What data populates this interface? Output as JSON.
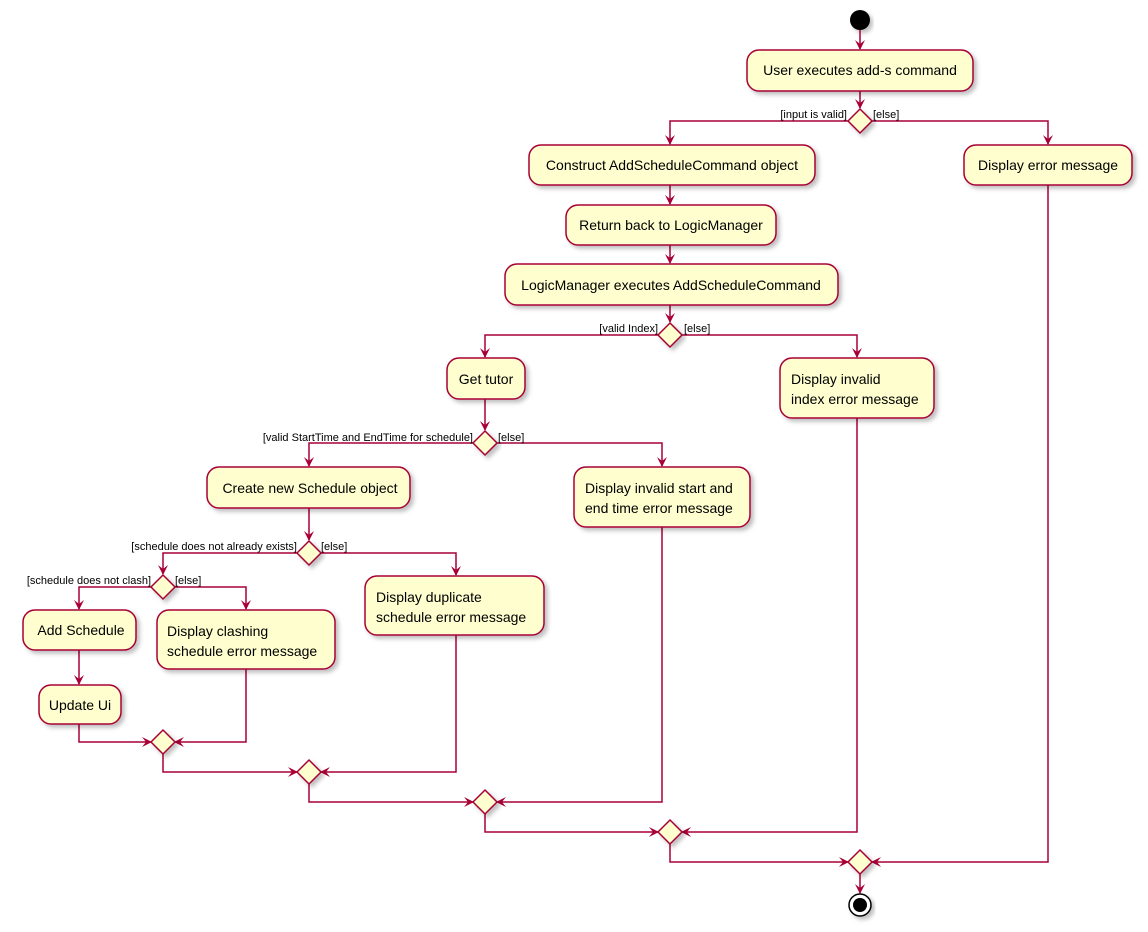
{
  "colors": {
    "border": "#A80036",
    "fill": "#FEFECE",
    "start_end": "#000000"
  },
  "actions": {
    "user_executes": "User executes add-s command",
    "construct": "Construct AddScheduleCommand object",
    "display_error": "Display error message",
    "return_back": "Return back to LogicManager",
    "logicmanager_executes": "LogicManager executes AddScheduleCommand",
    "get_tutor": "Get tutor",
    "invalid_index": [
      "Display invalid",
      "index error message"
    ],
    "create_schedule": "Create new Schedule object",
    "invalid_time": [
      "Display invalid start and",
      "end time error message"
    ],
    "duplicate": [
      "Display duplicate",
      "schedule error message"
    ],
    "add_schedule": "Add Schedule",
    "clashing": [
      "Display clashing",
      "schedule error message"
    ],
    "update_ui": "Update Ui"
  },
  "guards": {
    "input_valid": "[input is valid]",
    "input_else": "[else]",
    "valid_index": "[valid Index]",
    "index_else": "[else]",
    "valid_time": "[valid StartTime and EndTime for schedule]",
    "time_else": "[else]",
    "not_exists": "[schedule does not already exists]",
    "exists_else": "[else]",
    "not_clash": "[schedule does not clash]",
    "clash_else": "[else]"
  }
}
